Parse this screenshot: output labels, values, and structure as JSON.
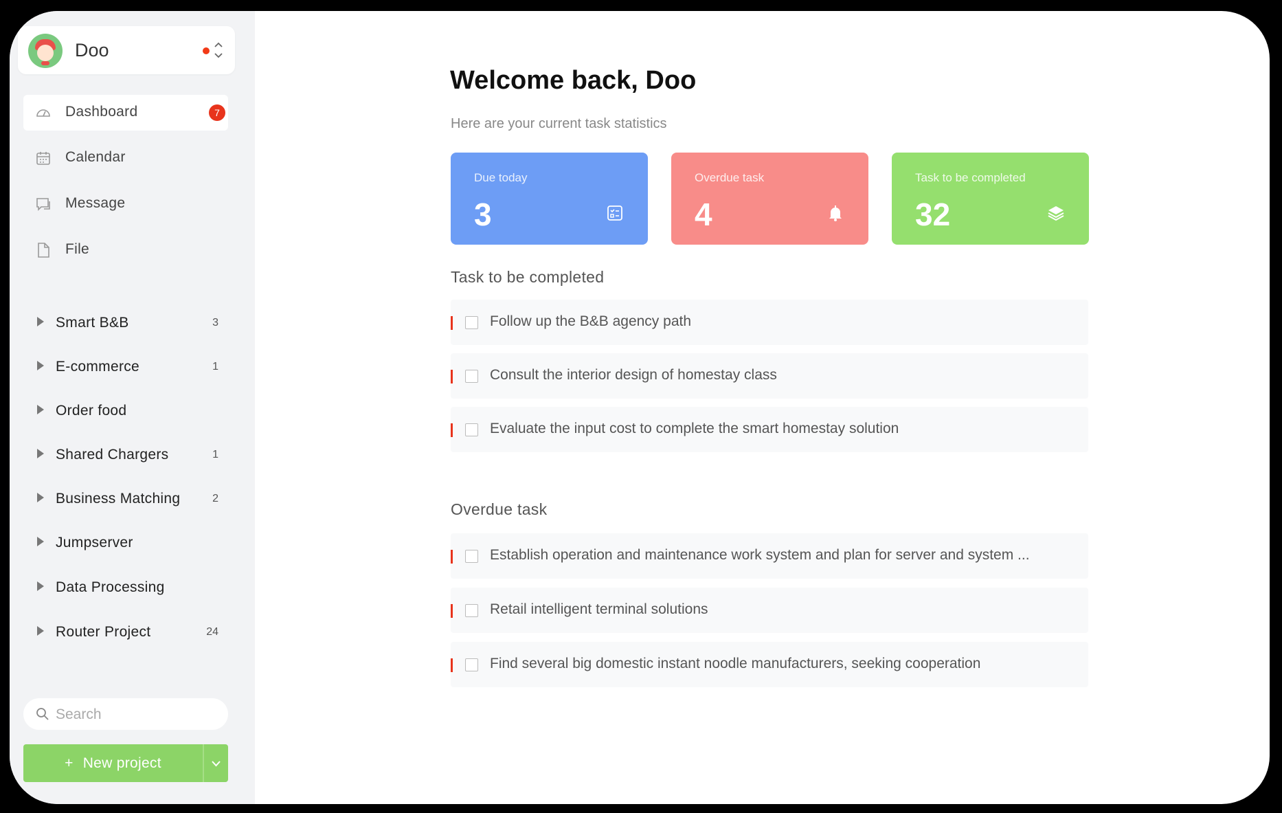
{
  "user": {
    "name": "Doo"
  },
  "nav": [
    {
      "label": "Dashboard",
      "badge": "7",
      "active": true,
      "icon": "dashboard-icon"
    },
    {
      "label": "Calendar",
      "icon": "calendar-icon"
    },
    {
      "label": "Message",
      "icon": "message-icon"
    },
    {
      "label": "File",
      "icon": "file-icon"
    }
  ],
  "projects": [
    {
      "label": "Smart B&B",
      "count": "3"
    },
    {
      "label": "E-commerce",
      "count": "1"
    },
    {
      "label": "Order food",
      "count": ""
    },
    {
      "label": "Shared Chargers",
      "count": "1"
    },
    {
      "label": "Business Matching",
      "count": "2"
    },
    {
      "label": "Jumpserver",
      "count": ""
    },
    {
      "label": "Data Processing",
      "count": ""
    },
    {
      "label": "Router Project",
      "count": "24"
    }
  ],
  "search": {
    "placeholder": "Search"
  },
  "new_project": {
    "label": "New project",
    "plus": "+"
  },
  "main": {
    "title": "Welcome back, Doo",
    "subtitle": "Here are your current task statistics",
    "stats": [
      {
        "label": "Due today",
        "value": "3",
        "color": "#6d9df5",
        "icon": "checklist-icon"
      },
      {
        "label": "Overdue task",
        "value": "4",
        "color": "#f88c89",
        "icon": "bell-icon"
      },
      {
        "label": "Task to be completed",
        "value": "32",
        "color": "#95df6e",
        "icon": "layers-icon"
      }
    ],
    "todo_title": "Task to be completed",
    "todo": [
      "Follow up the B&B agency path",
      "Consult the interior design of homestay class",
      "Evaluate the input cost to complete the smart homestay solution"
    ],
    "overdue_title": "Overdue task",
    "overdue": [
      "Establish operation and maintenance work system and plan for server and system ...",
      "Retail intelligent terminal solutions",
      "Find several big domestic instant noodle manufacturers, seeking cooperation"
    ]
  },
  "colors": {
    "accent_red": "#e8341c",
    "green": "#8cd467",
    "sidebar_bg": "#f2f3f5"
  }
}
